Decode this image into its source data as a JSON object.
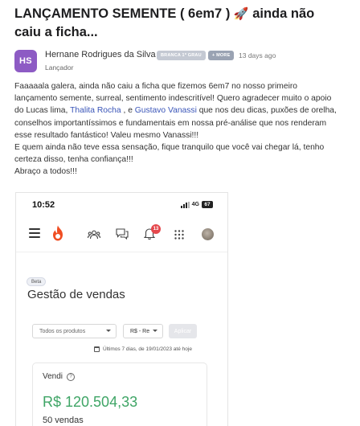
{
  "post": {
    "title": "LANÇAMENTO SEMENTE ( 6em7 )",
    "title_emoji": "🚀",
    "title_rest": "ainda não caiu a ficha...",
    "author": {
      "initials": "HS",
      "avatar_color": "#8d5bc4",
      "name": "Hernane Rodrigues da Silva",
      "badge_1": "BRANCA 1º GRAU",
      "badge_2": "+ MORE",
      "time": "13 days ago",
      "role": "Lançador"
    },
    "body": {
      "p1": "Faaaaala galera, ainda não caiu a ficha que fizemos 6em7 no nosso primeiro lançamento semente, surreal, sentimento indescritível! Quero agradecer muito o apoio do Lucas lima, ",
      "mention_1": "Thalita Rocha",
      "p2": " , e ",
      "mention_2": "Gustavo Vanassi",
      "p3": " que nos deu dicas, puxões de orelha, conselhos importantíssimos e fundamentais em nossa pré-análise que nos renderam esse resultado fantástico! Valeu mesmo Vanassi!!!",
      "line_2": "E quem ainda não teve essa sensação, fique tranquilo que você vai chegar lá, tenho certeza disso, tenha confiança!!!",
      "line_3": "Abraço a todos!!!"
    },
    "link_color": "#3a55b8"
  },
  "phone": {
    "status": {
      "time": "10:52",
      "network": "4G",
      "battery": "67"
    },
    "app_bar": {
      "icons": [
        "menu-icon",
        "hotmart-flame-icon",
        "users-icon",
        "chat-icon",
        "bell-icon",
        "apps-grid-icon",
        "user-avatar"
      ],
      "notification_count": "13",
      "brand_color": "#f04e23"
    },
    "beta_label": "Beta",
    "page_title": "Gestão de vendas",
    "filters": {
      "product_placeholder": "Todos os produtos",
      "currency": "R$ - Re",
      "apply_label": "Aplicar"
    },
    "date_range": "Últimos 7 dias, de 19/01/2023 até hoje",
    "card": {
      "label": "Vendi",
      "help": "?",
      "value": "R$ 120.504,33",
      "value_color": "#3fa566",
      "count": "50 vendas"
    }
  }
}
